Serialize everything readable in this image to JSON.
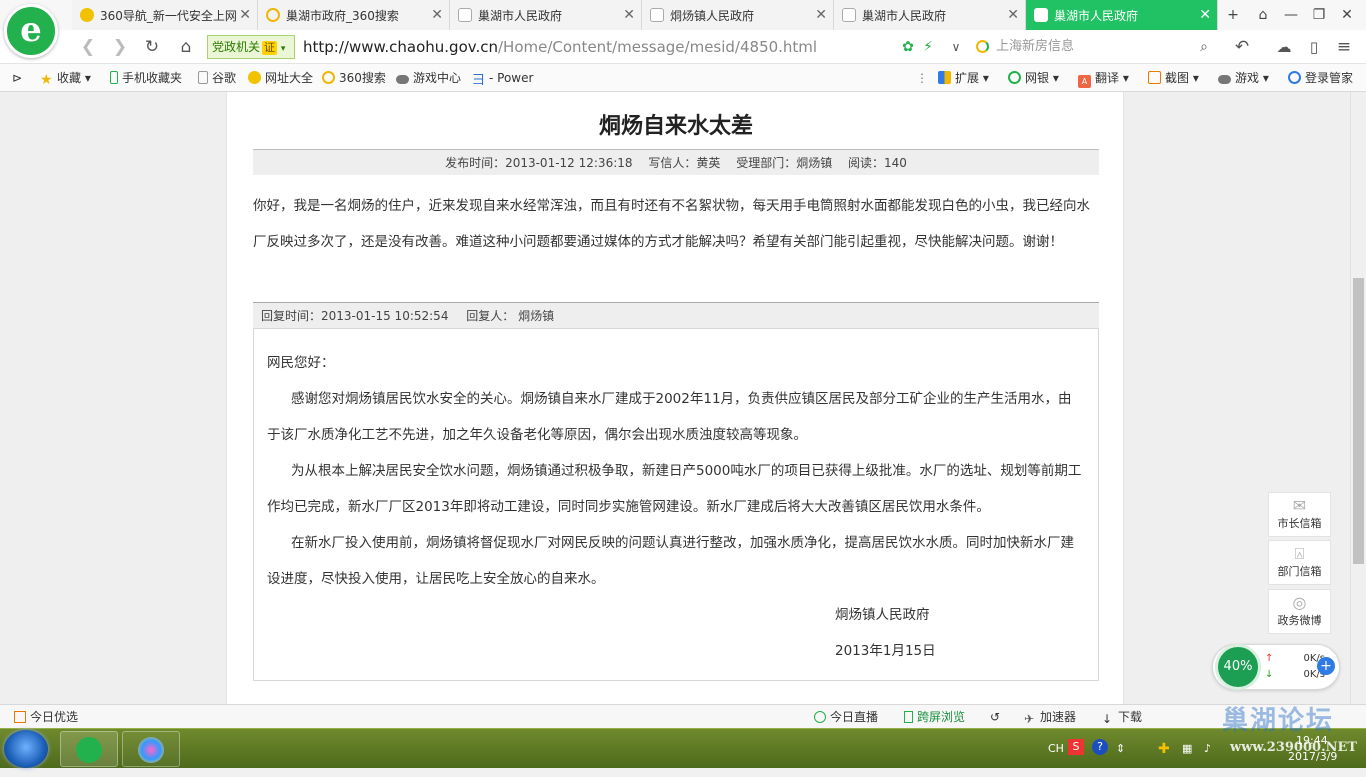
{
  "tabs": [
    {
      "label": "360导航_新一代安全上网"
    },
    {
      "label": "巢湖市政府_360搜索"
    },
    {
      "label": "巢湖市人民政府"
    },
    {
      "label": "烔炀镇人民政府"
    },
    {
      "label": "巢湖市人民政府"
    },
    {
      "label": "巢湖市人民政府"
    }
  ],
  "toolbar": {
    "logo": "e",
    "gov_label": "党政机关",
    "cert_badge": "证",
    "url_host": "http://www.chaohu.gov.cn",
    "url_path": "/Home/Content/message/mesid/4850.html",
    "search_placeholder": "上海新房信息"
  },
  "bookmarks": [
    {
      "label": "收藏"
    },
    {
      "label": "手机收藏夹"
    },
    {
      "label": "谷歌"
    },
    {
      "label": "网址大全"
    },
    {
      "label": "360搜索"
    },
    {
      "label": "游戏中心"
    },
    {
      "label": "- Power"
    }
  ],
  "bookmark_tools": [
    {
      "label": "扩展"
    },
    {
      "label": "网银"
    },
    {
      "label": "翻译"
    },
    {
      "label": "截图"
    },
    {
      "label": "游戏"
    },
    {
      "label": "登录管家"
    }
  ],
  "article": {
    "title": "烔炀自来水太差",
    "publish_time": "发布时间：2013-01-12 12:36:18",
    "writer": "写信人：黄英",
    "department": "受理部门：烔炀镇",
    "reads": "阅读：140",
    "question": "你好，我是一名烔炀的住户，近来发现自来水经常浑浊，而且有时还有不名絮状物，每天用手电筒照射水面都能发现白色的小虫，我已经向水厂反映过多次了，还是没有改善。难道这种小问题都要通过媒体的方式才能解决吗？希望有关部门能引起重视，尽快能解决问题。谢谢！",
    "reply_time": "回复时间：2013-01-15 10:52:54",
    "replier": "回复人： 烔炀镇",
    "reply_greeting": "网民您好：",
    "reply_p1": "感谢您对烔炀镇居民饮水安全的关心。烔炀镇自来水厂建成于2002年11月，负责供应镇区居民及部分工矿企业的生产生活用水，由于该厂水质净化工艺不先进，加之年久设备老化等原因，偶尔会出现水质浊度较高等现象。",
    "reply_p2": "为从根本上解决居民安全饮水问题，烔炀镇通过积极争取，新建日产5000吨水厂的项目已获得上级批准。水厂的选址、规划等前期工作均已完成，新水厂厂区2013年即将动工建设，同时同步实施管网建设。新水厂建成后将大大改善镇区居民饮用水条件。",
    "reply_p3": "在新水厂投入使用前，烔炀镇将督促现水厂对网民反映的问题认真进行整改，加强水质净化，提高居民饮水水质。同时加快新水厂建设进度，尽快投入使用，让居民吃上安全放心的自来水。",
    "reply_signature": "烔炀镇人民政府",
    "reply_date": "2013年1月15日"
  },
  "side_buttons": [
    {
      "label": "市长信箱"
    },
    {
      "label": "部门信箱"
    },
    {
      "label": "政务微博"
    }
  ],
  "speed_widget": {
    "percent": "40%",
    "upload": "0K/s",
    "download": "0K/s"
  },
  "statusbar": {
    "left": "今日优选",
    "live": "今日直播",
    "cast": "跨屏浏览",
    "accelerate": "加速器",
    "download": "下载"
  },
  "taskbar": {
    "lang": "CH",
    "time": "19:44",
    "date": "2017/3/9"
  },
  "watermark": {
    "text": "巢湖论坛",
    "url": "www.239000.NET"
  },
  "colors": {
    "accent_green": "#21c263",
    "active_tab": "#21c263"
  }
}
